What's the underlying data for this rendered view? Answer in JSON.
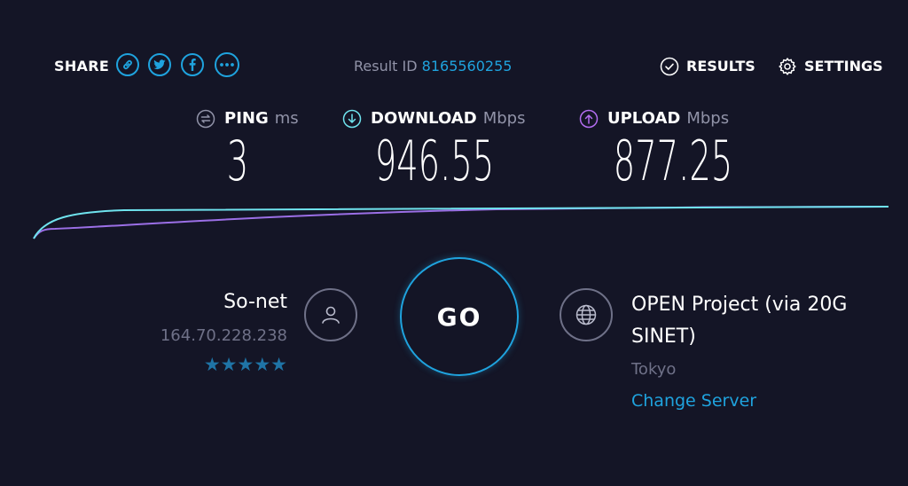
{
  "header": {
    "share_label": "SHARE",
    "share_icons": [
      "link-icon",
      "twitter-icon",
      "facebook-icon",
      "more-icon"
    ],
    "result_id_label": "Result ID",
    "result_id_value": "8165560255",
    "results_label": "RESULTS",
    "settings_label": "SETTINGS"
  },
  "metrics": {
    "ping": {
      "label": "PING",
      "unit": "ms",
      "value": "3",
      "icon": "ping-icon"
    },
    "download": {
      "label": "DOWNLOAD",
      "unit": "Mbps",
      "value": "946.55",
      "icon": "download-icon"
    },
    "upload": {
      "label": "UPLOAD",
      "unit": "Mbps",
      "value": "877.25",
      "icon": "upload-icon"
    }
  },
  "isp": {
    "name": "So-net",
    "ip": "164.70.228.238",
    "rating_stars": "★★★★★",
    "rating": 5,
    "icon": "user-icon"
  },
  "go_label": "GO",
  "server": {
    "name": "OPEN Project (via 20G SINET)",
    "location": "Tokyo",
    "change_label": "Change Server",
    "icon": "globe-icon"
  },
  "colors": {
    "background": "#141526",
    "accent": "#1fa3de",
    "download_line": "#6fe3ee",
    "upload_line": "#9b6fe6",
    "muted": "#6f7188",
    "star": "#1f74a6"
  }
}
